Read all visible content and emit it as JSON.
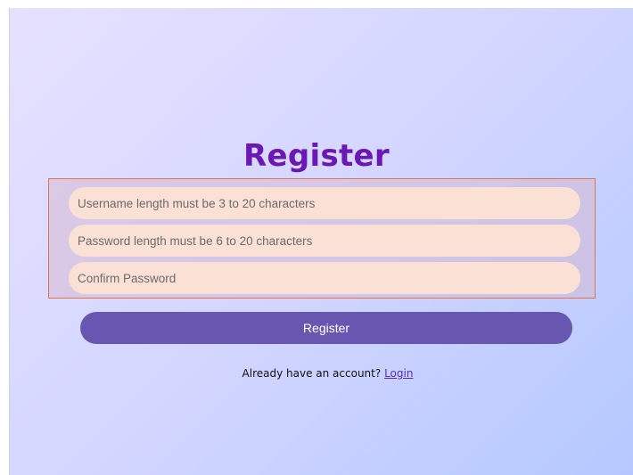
{
  "form": {
    "title": "Register",
    "username_placeholder": "Username length must be 3 to 20 characters",
    "password_placeholder": "Password length must be 6 to 20 characters",
    "confirm_placeholder": "Confirm Password",
    "submit_label": "Register",
    "footer_text": "Already have an account?",
    "login_link": "Login"
  },
  "colors": {
    "title": "#6a17b3",
    "button": "#6857b1",
    "field_bg": "#fbe1d5",
    "highlight_border": "#e2744a"
  }
}
